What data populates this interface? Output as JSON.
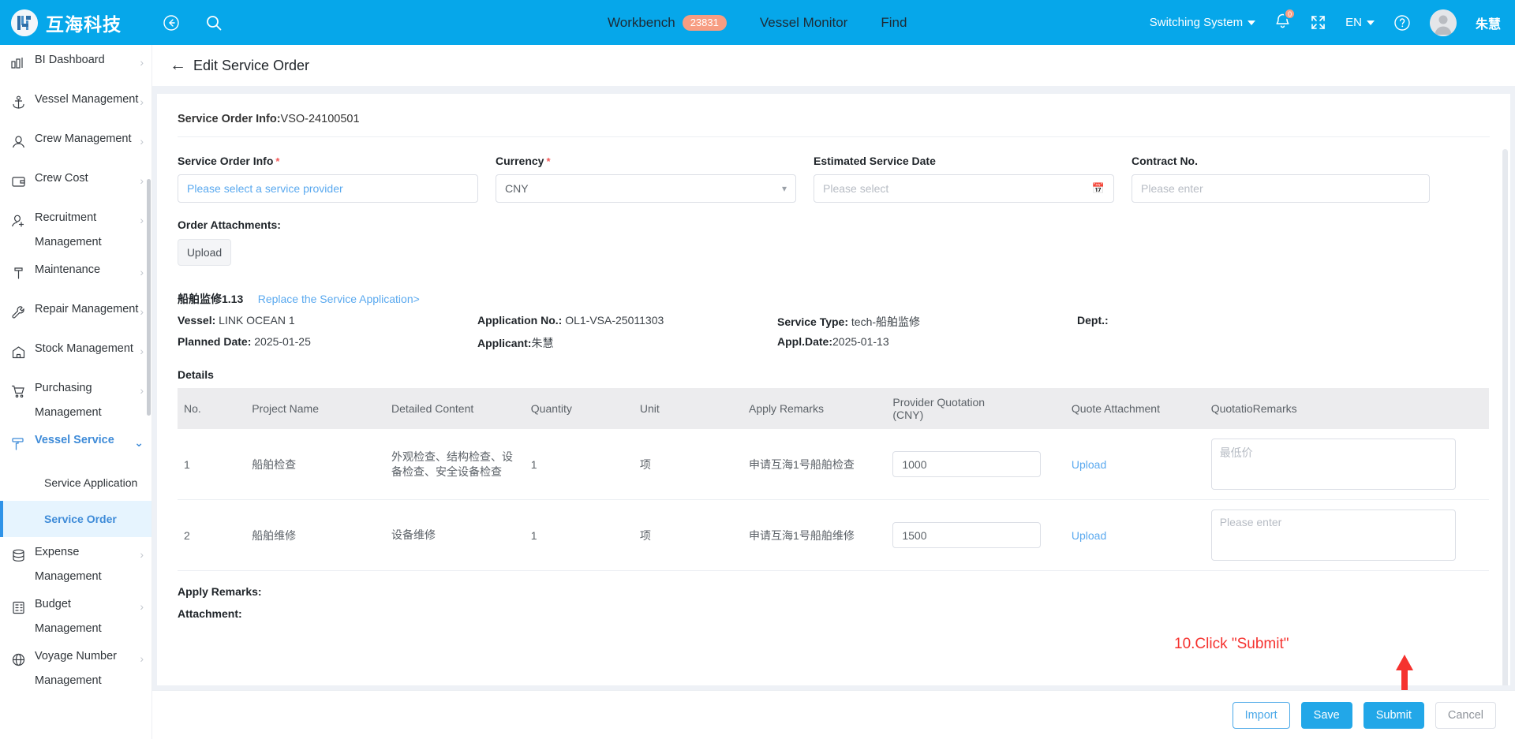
{
  "topbar": {
    "brand_name": "互海科技",
    "back_icon": "back-arrow-icon",
    "search_icon": "search-icon",
    "nav": [
      {
        "label": "Workbench",
        "badge": "23831"
      },
      {
        "label": "Vessel Monitor",
        "badge": ""
      },
      {
        "label": "Find",
        "badge": ""
      }
    ],
    "switching_system": "Switching System",
    "notification_count": "0",
    "language": "EN",
    "username": "朱慧"
  },
  "sidebar": {
    "items": [
      {
        "label": "BI Dashboard",
        "icon": "chart-bar-icon",
        "arrow": "›",
        "active": false
      },
      {
        "label": "Vessel Management",
        "icon": "anchor-icon",
        "arrow": "›",
        "active": false
      },
      {
        "label": "Crew Management",
        "icon": "person-icon",
        "arrow": "›",
        "active": false
      },
      {
        "label": "Crew Cost",
        "icon": "wallet-icon",
        "arrow": "›",
        "active": false
      },
      {
        "label": "Recruitment Management",
        "icon": "person-add-icon",
        "arrow": "›",
        "active": false
      },
      {
        "label": "Maintenance",
        "icon": "hammer-icon",
        "arrow": "›",
        "active": false
      },
      {
        "label": "Repair Management",
        "icon": "wrench-icon",
        "arrow": "›",
        "active": false
      },
      {
        "label": "Stock Management",
        "icon": "home-icon",
        "arrow": "›",
        "active": false
      },
      {
        "label": "Purchasing Management",
        "icon": "cart-icon",
        "arrow": "›",
        "active": false
      },
      {
        "label": "Vessel Service",
        "icon": "paint-roller-icon",
        "arrow": "⌄",
        "active": true
      },
      {
        "label": "Expense Management",
        "icon": "database-icon",
        "arrow": "›",
        "active": false
      },
      {
        "label": "Budget Management",
        "icon": "calculator-icon",
        "arrow": "›",
        "active": false
      },
      {
        "label": "Voyage Number Management",
        "icon": "globe-icon",
        "arrow": "›",
        "active": false
      }
    ],
    "sub_items": [
      {
        "label": "Service Application",
        "selected": false
      },
      {
        "label": "Service Order",
        "selected": true
      }
    ]
  },
  "page": {
    "back_arrow": "←",
    "title": "Edit Service Order",
    "order_info_label": "Service Order Info:",
    "order_info_value": "VSO-24100501"
  },
  "form": {
    "fields": [
      {
        "label": "Service Order Info",
        "required": true,
        "placeholder": "Please select a service provider",
        "value": "",
        "type": "provider"
      },
      {
        "label": "Currency",
        "required": true,
        "placeholder": "",
        "value": "CNY",
        "type": "select"
      },
      {
        "label": "Estimated Service Date",
        "required": false,
        "placeholder": "Please select",
        "value": "",
        "type": "date"
      },
      {
        "label": "Contract No.",
        "required": false,
        "placeholder": "Please enter",
        "value": "",
        "type": "text"
      }
    ],
    "attachments_label": "Order Attachments:",
    "upload_label": "Upload"
  },
  "application": {
    "title": "船舶监修1.13",
    "replace_link": "Replace the Service Application>",
    "vessel_label": "Vessel:",
    "vessel_value": "LINK OCEAN 1",
    "application_no_label": "Application No.:",
    "application_no_value": "OL1-VSA-25011303",
    "service_type_label": "Service Type:",
    "service_type_value": "tech-船舶监修",
    "dept_label": "Dept.:",
    "dept_value": "",
    "planned_date_label": "Planned Date:",
    "planned_date_value": "2025-01-25",
    "applicant_label": "Applicant:",
    "applicant_value": "朱慧",
    "appl_date_label": "Appl.Date:",
    "appl_date_value": "2025-01-13"
  },
  "details": {
    "section_title": "Details",
    "columns": [
      "No.",
      "Project Name",
      "Detailed Content",
      "Quantity",
      "Unit",
      "Apply Remarks",
      "Provider Quotation (CNY)",
      "Quote Attachment",
      "QuotationRemarks"
    ],
    "quotation_header_line1": "Provider Quotation",
    "quotation_header_line2": "(CNY)",
    "quotation_remarks_a": "Quotatio",
    "quotation_remarks_b": "Remarks",
    "rows": [
      {
        "no": "1",
        "project_name": "船舶检查",
        "detailed_content": "外观检查、结构检查、设备检查、安全设备检查",
        "quantity": "1",
        "unit": "项",
        "apply_remarks": "申请互海1号船舶检查",
        "quotation": "1000",
        "quote_attachment": "Upload",
        "quotation_remarks": "最低价"
      },
      {
        "no": "2",
        "project_name": "船舶维修",
        "detailed_content": "设备维修",
        "quantity": "1",
        "unit": "项",
        "apply_remarks": "申请互海1号船舶维修",
        "quotation": "1500",
        "quote_attachment": "Upload",
        "quotation_remarks": "Please enter"
      }
    ]
  },
  "bottom": {
    "apply_remarks_label": "Apply Remarks:",
    "attachment_label": "Attachment:"
  },
  "annotation": {
    "text": "10.Click \"Submit\"",
    "color": "#f5322f"
  },
  "footer": {
    "import_label": "Import",
    "save_label": "Save",
    "submit_label": "Submit",
    "cancel_label": "Cancel"
  },
  "colors": {
    "brand_blue": "#06a7ea",
    "accent_blue": "#22a7e8",
    "link_blue": "#5aa9ef",
    "badge_orange": "#f79d82",
    "annotation_red": "#f5322f"
  }
}
